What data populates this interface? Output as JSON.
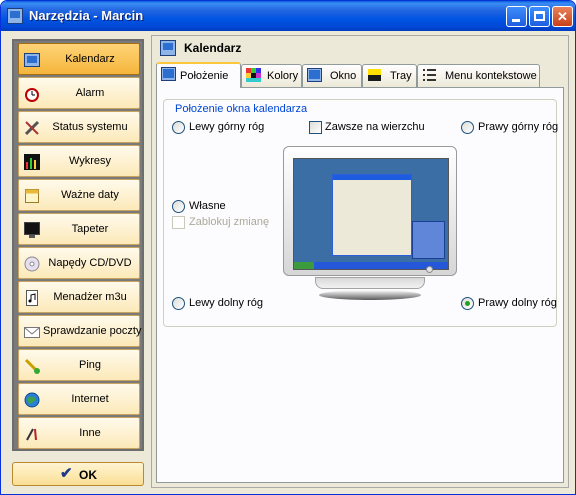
{
  "window": {
    "title": "Narzędzia - Marcin",
    "accent": "#0054E3"
  },
  "titlebar_buttons": {
    "close_glyph": "✕"
  },
  "sidebar": {
    "items": [
      {
        "label": "Kalendarz",
        "icon": "calendar-icon",
        "active": true
      },
      {
        "label": "Alarm",
        "icon": "alarm-clock-icon"
      },
      {
        "label": "Status systemu",
        "icon": "tools-icon"
      },
      {
        "label": "Wykresy",
        "icon": "bar-chart-icon"
      },
      {
        "label": "Ważne daty",
        "icon": "date-icon"
      },
      {
        "label": "Tapeter",
        "icon": "wallpaper-icon"
      },
      {
        "label": "Napędy CD/DVD",
        "icon": "cd-icon"
      },
      {
        "label": "Menadżer m3u",
        "icon": "music-file-icon"
      },
      {
        "label": "Sprawdzanie poczty",
        "icon": "mail-icon"
      },
      {
        "label": "Ping",
        "icon": "ping-icon"
      },
      {
        "label": "Internet",
        "icon": "globe-icon"
      },
      {
        "label": "Inne",
        "icon": "misc-tools-icon"
      }
    ]
  },
  "ok_button": {
    "label": "OK"
  },
  "panel": {
    "title": "Kalendarz"
  },
  "tabs": [
    {
      "label": "Położenie",
      "active": true
    },
    {
      "label": "Kolory"
    },
    {
      "label": "Okno"
    },
    {
      "label": "Tray"
    },
    {
      "label": "Menu kontekstowe"
    }
  ],
  "position_group": {
    "legend": "Położenie okna kalendarza",
    "top_left": "Lewy górny róg",
    "always_on_top": "Zawsze na wierzchu",
    "top_right": "Prawy górny róg",
    "custom": "Własne",
    "lock_changes": "Zablokuj zmianę",
    "bottom_left": "Lewy dolny róg",
    "bottom_right": "Prawy dolny róg",
    "selected": "bottom_right"
  }
}
